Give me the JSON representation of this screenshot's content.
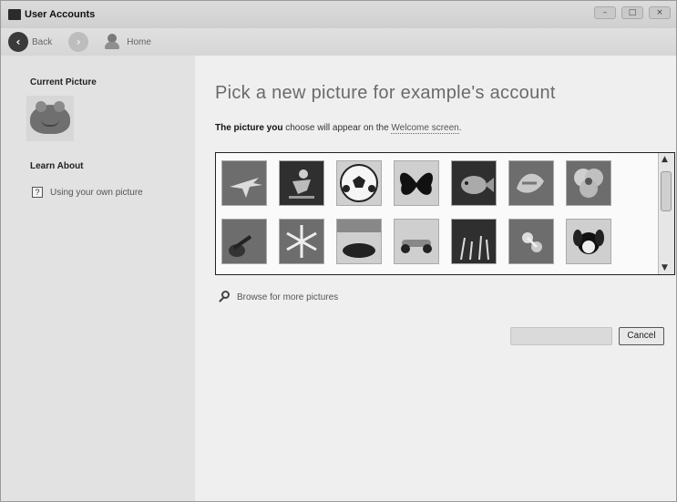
{
  "window": {
    "title": "User Accounts"
  },
  "nav": {
    "back_label": "Back",
    "home_label": "Home"
  },
  "sidebar": {
    "current_picture_heading": "Current Picture",
    "learn_about_heading": "Learn About",
    "learn_link": "Using your own picture"
  },
  "main": {
    "title": "Pick a new picture for example's account",
    "subtitle_prefix": "The picture you",
    "subtitle_mid": " choose will appear on the ",
    "subtitle_link": "Welcome screen",
    "subtitle_suffix": ".",
    "browse_label": "Browse for more pictures",
    "cancel_label": "Cancel"
  },
  "pictures": [
    "airplane",
    "skateboarder",
    "soccer-ball",
    "butterfly",
    "fish",
    "koi",
    "flower",
    "guitar",
    "snowflake",
    "horses",
    "race-car",
    "drums",
    "robot",
    "dog"
  ]
}
